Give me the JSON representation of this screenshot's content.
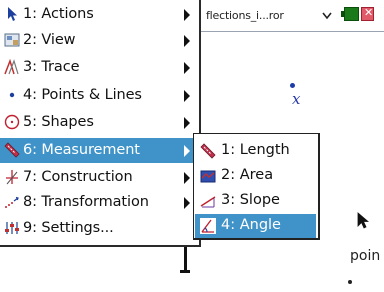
{
  "document": {
    "tab_title": "flections_i...ror",
    "point_label": "x",
    "text_fragment": "poin"
  },
  "main_menu": {
    "items": [
      {
        "label": "1: Actions",
        "icon": "pointer-arrow-icon",
        "has_submenu": true
      },
      {
        "label": "2: View",
        "icon": "view-icon",
        "has_submenu": true
      },
      {
        "label": "3: Trace",
        "icon": "trace-icon",
        "has_submenu": true
      },
      {
        "label": "4: Points & Lines",
        "icon": "point-icon",
        "has_submenu": true
      },
      {
        "label": "5: Shapes",
        "icon": "circle-icon",
        "has_submenu": true
      },
      {
        "label": "6: Measurement",
        "icon": "ruler-icon",
        "has_submenu": true,
        "selected": true
      },
      {
        "label": "7: Construction",
        "icon": "construction-icon",
        "has_submenu": true
      },
      {
        "label": "8: Transformation",
        "icon": "transformation-icon",
        "has_submenu": true
      },
      {
        "label": "9: Settings...",
        "icon": "settings-icon",
        "has_submenu": false
      }
    ]
  },
  "sub_menu": {
    "items": [
      {
        "label": "1: Length",
        "icon": "length-icon"
      },
      {
        "label": "2: Area",
        "icon": "area-icon"
      },
      {
        "label": "3: Slope",
        "icon": "slope-icon"
      },
      {
        "label": "4: Angle",
        "icon": "angle-icon",
        "selected": true
      }
    ]
  },
  "colors": {
    "selection": "#3f93c8",
    "point": "#1c3ca8"
  }
}
